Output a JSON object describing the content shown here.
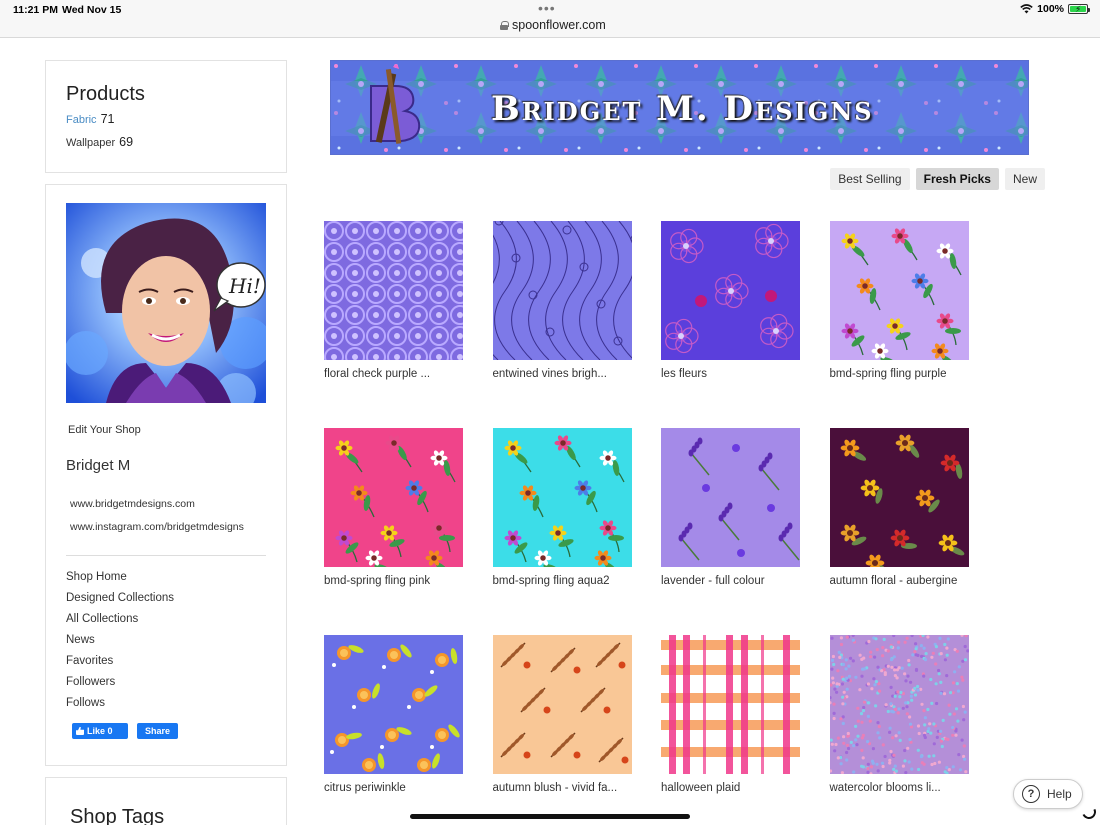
{
  "status_bar": {
    "time": "11:21 PM",
    "date": "Wed Nov 15",
    "url": "spoonflower.com",
    "battery": "100%",
    "battery_color": "#2bd54b"
  },
  "sidebar": {
    "products": {
      "title": "Products",
      "items": [
        {
          "label": "Fabric",
          "count": "71"
        },
        {
          "label": "Wallpaper",
          "count": "69"
        }
      ]
    },
    "profile": {
      "avatar_speech": "Hi!",
      "edit_label": "Edit Your Shop",
      "owner": "Bridget M",
      "links": [
        "www.bridgetmdesigns.com",
        "www.instagram.com/bridgetmdesigns"
      ],
      "nav": [
        "Shop Home",
        "Designed Collections",
        "All Collections",
        "News",
        "Favorites",
        "Followers",
        "Follows"
      ],
      "fb_like": "Like 0",
      "fb_share": "Share",
      "fb_color": "#1877f2"
    },
    "tags_title": "Shop Tags"
  },
  "banner": {
    "title": "Bridget M. Designs"
  },
  "sort_tabs": [
    {
      "label": "Best Selling",
      "active": false
    },
    {
      "label": "Fresh Picks",
      "active": true
    },
    {
      "label": "New",
      "active": false
    }
  ],
  "designs": [
    {
      "caption": "floral check purple ...",
      "pattern": "check"
    },
    {
      "caption": "entwined vines brigh...",
      "pattern": "vines"
    },
    {
      "caption": "les fleurs",
      "pattern": "fleurs"
    },
    {
      "caption": "bmd-spring fling purple",
      "pattern": "spring-purple"
    },
    {
      "caption": "bmd-spring fling pink",
      "pattern": "spring-pink"
    },
    {
      "caption": "bmd-spring fling aqua2",
      "pattern": "spring-aqua"
    },
    {
      "caption": "lavender - full colour",
      "pattern": "lavender"
    },
    {
      "caption": "autumn floral - aubergine",
      "pattern": "aubergine"
    },
    {
      "caption": "citrus periwinkle",
      "pattern": "citrus"
    },
    {
      "caption": "autumn blush - vivid fa...",
      "pattern": "blush"
    },
    {
      "caption": "halloween plaid",
      "pattern": "plaid"
    },
    {
      "caption": "watercolor blooms li...",
      "pattern": "blooms"
    }
  ],
  "help_label": "Help"
}
